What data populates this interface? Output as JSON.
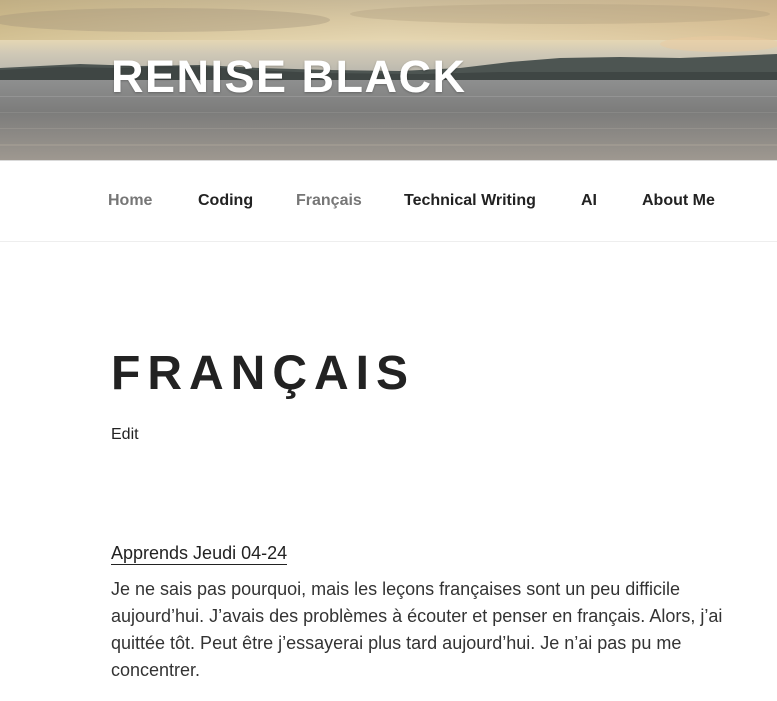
{
  "site": {
    "title": "RENISE BLACK"
  },
  "nav": {
    "items": [
      {
        "label": "Home"
      },
      {
        "label": "Coding"
      },
      {
        "label": "Français"
      },
      {
        "label": "Technical Writing"
      },
      {
        "label": "AI"
      },
      {
        "label": "About Me"
      }
    ]
  },
  "page": {
    "title": "FRANÇAIS",
    "edit_label": "Edit"
  },
  "post": {
    "title": "Apprends Jeudi 04-24",
    "excerpt": "Je ne sais pas pourquoi, mais les leçons françaises sont un peu difficile aujourd’hui. J’avais des problèmes à écouter et penser en français. Alors, j’ai quittée tôt. Peut être j’essayerai plus tard aujourd’hui. Je n’ai pas pu me concentrer."
  },
  "colors": {
    "text": "#222222",
    "muted_nav": "#767676",
    "body_text": "#333333",
    "header_title": "#ffffff"
  }
}
